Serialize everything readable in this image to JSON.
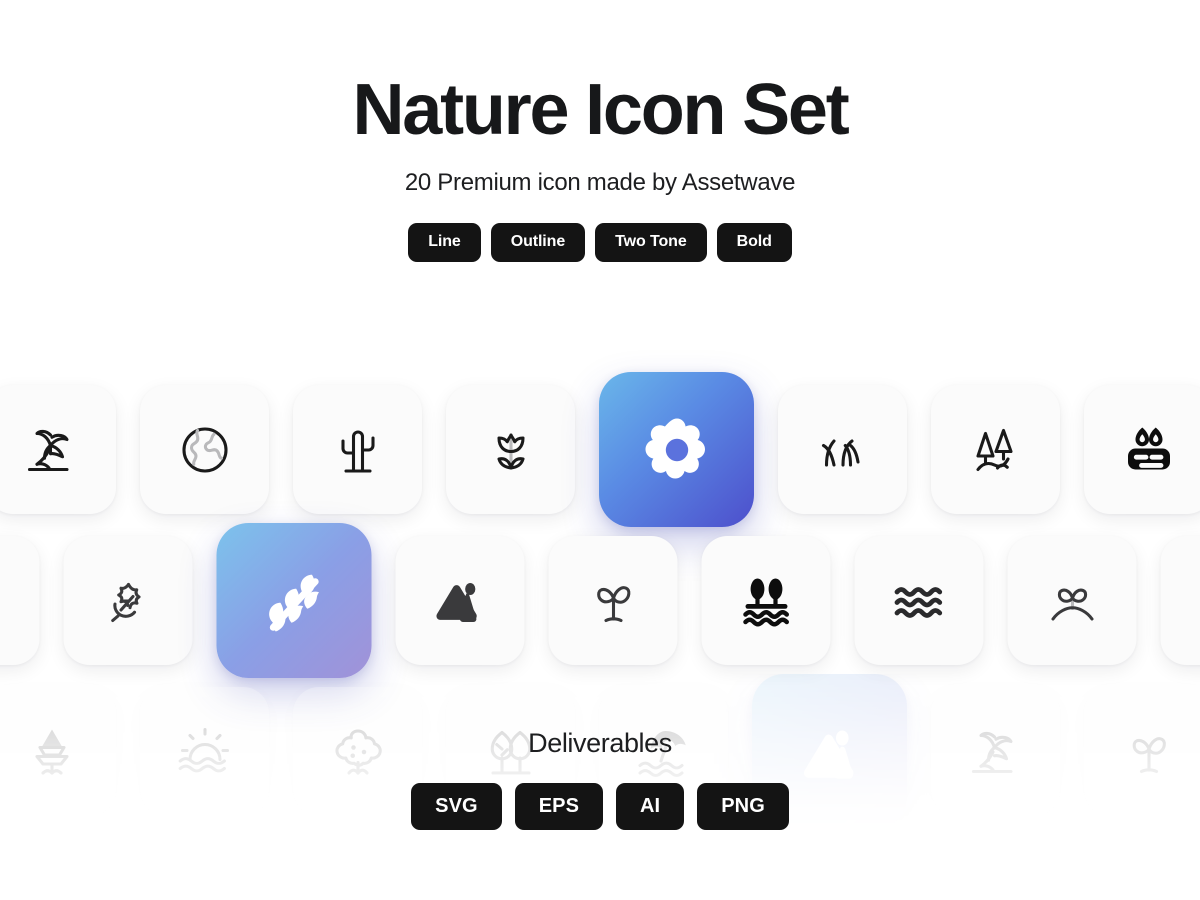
{
  "header": {
    "title": "Nature Icon Set",
    "subtitle": "20 Premium icon made by Assetwave"
  },
  "style_tags": [
    {
      "label": "Line"
    },
    {
      "label": "Outline"
    },
    {
      "label": "Two Tone"
    },
    {
      "label": "Bold"
    }
  ],
  "deliverables": {
    "label": "Deliverables",
    "formats": [
      {
        "label": "SVG"
      },
      {
        "label": "EPS"
      },
      {
        "label": "AI"
      },
      {
        "label": "PNG"
      }
    ]
  },
  "colors": {
    "page_background": "#ffffff",
    "card_background": "#fbfbfb",
    "pill_background": "#141414",
    "pill_text": "#ffffff",
    "icon_stroke": "#1a1a1a",
    "gradient_start": "#6ab7ea",
    "gradient_end": "#4d4fcc",
    "title_text": "#17181a"
  },
  "icon_rows": [
    {
      "row": 1,
      "icons": [
        {
          "name": "palm-tree-icon",
          "style": "line"
        },
        {
          "name": "globe-earth-icon",
          "style": "two-tone"
        },
        {
          "name": "cactus-icon",
          "style": "line"
        },
        {
          "name": "tulip-flower-icon",
          "style": "two-tone"
        },
        {
          "name": "flower-icon",
          "style": "bold",
          "featured": true
        },
        {
          "name": "grass-icon",
          "style": "line"
        },
        {
          "name": "forest-river-icon",
          "style": "line"
        },
        {
          "name": "potted-plant-icon",
          "style": "bold"
        }
      ]
    },
    {
      "row": 2,
      "icons": [
        {
          "name": "cactus-icon",
          "style": "bold"
        },
        {
          "name": "maple-leaf-icon",
          "style": "outline"
        },
        {
          "name": "branch-leaves-icon",
          "style": "bold",
          "featured": true
        },
        {
          "name": "mountain-sun-icon",
          "style": "bold"
        },
        {
          "name": "sprout-icon",
          "style": "outline"
        },
        {
          "name": "trees-water-icon",
          "style": "bold"
        },
        {
          "name": "water-waves-icon",
          "style": "bold"
        },
        {
          "name": "seedling-hill-icon",
          "style": "outline"
        },
        {
          "name": "branch-leaves-icon",
          "style": "outline"
        }
      ]
    },
    {
      "row": 3,
      "icons": [
        {
          "name": "pine-tree-icon",
          "style": "two-tone"
        },
        {
          "name": "sunrise-water-icon",
          "style": "outline"
        },
        {
          "name": "bush-shrub-icon",
          "style": "outline"
        },
        {
          "name": "two-trees-icon",
          "style": "outline"
        },
        {
          "name": "beach-umbrella-icon",
          "style": "two-tone"
        },
        {
          "name": "mountain-sun-icon",
          "style": "bold",
          "featured": true
        },
        {
          "name": "palm-tree-icon",
          "style": "outline"
        },
        {
          "name": "sprout-icon",
          "style": "outline"
        }
      ]
    }
  ]
}
